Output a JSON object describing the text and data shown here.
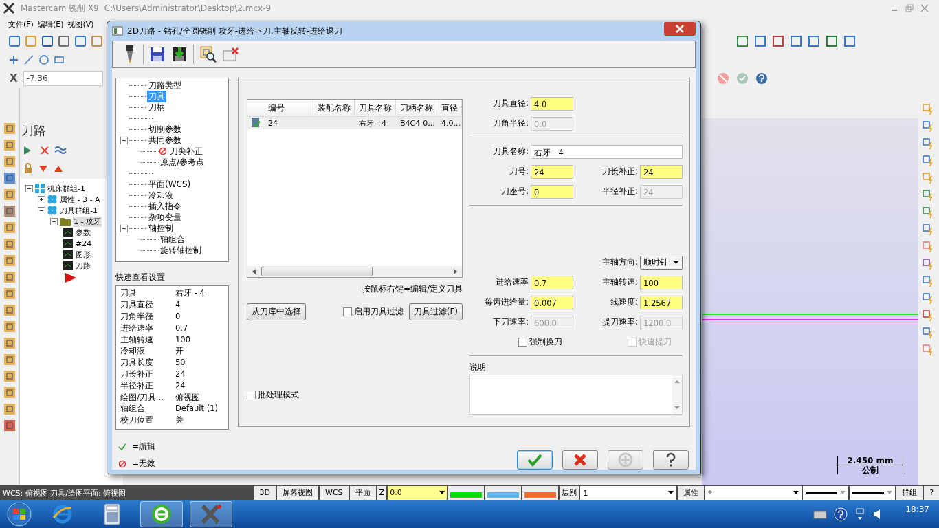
{
  "app": {
    "title": "Mastercam 铣削 X9",
    "path": "C:\\Users\\Administrator\\Desktop\\2.mcx-9",
    "menus": [
      "文件(F)",
      "编辑(E)",
      "视图(V)"
    ],
    "coordinate": {
      "label": "X",
      "value": "-7.36"
    },
    "manager": {
      "title": "刀路",
      "tree": [
        {
          "label": "机床群组-1",
          "expanded": true,
          "selected": false,
          "children": [
            {
              "label": "属性 - 3 - A",
              "expanded": false,
              "selected": false
            },
            {
              "label": "刀具群组-1",
              "expanded": true,
              "selected": false,
              "children": [
                {
                  "label": "1 - 攻牙",
                  "expanded": true,
                  "selected": true,
                  "children": [
                    {
                      "label": "参数",
                      "selected": false
                    },
                    {
                      "label": "#24",
                      "selected": false
                    },
                    {
                      "label": "图形",
                      "selected": false
                    },
                    {
                      "label": "刀路",
                      "selected": false
                    }
                  ]
                }
              ]
            }
          ]
        }
      ]
    },
    "scale": {
      "value": "2.450 mm",
      "unit": "公制"
    },
    "status_text": "WCS: 俯视图  刀具/绘图平面: 俯视图",
    "bottom_bar": [
      {
        "kind": "button",
        "text": "3D"
      },
      {
        "kind": "button",
        "text": "屏幕视图"
      },
      {
        "kind": "button",
        "text": "WCS"
      },
      {
        "kind": "button",
        "text": "平面"
      },
      {
        "kind": "label",
        "text": "Z"
      },
      {
        "kind": "field",
        "text": "0.0"
      },
      {
        "kind": "swatch",
        "color": "#00e000"
      },
      {
        "kind": "swatch",
        "color": "#60b8f0"
      },
      {
        "kind": "swatch",
        "color": "#f07030"
      },
      {
        "kind": "label",
        "text": "层别"
      },
      {
        "kind": "select",
        "text": "1"
      },
      {
        "kind": "button",
        "text": "属性"
      },
      {
        "kind": "select",
        "text": "*"
      },
      {
        "kind": "line"
      },
      {
        "kind": "line"
      },
      {
        "kind": "button",
        "text": "群组"
      },
      {
        "kind": "button",
        "text": "?"
      }
    ]
  },
  "dialog": {
    "title": "2D刀路 - 钻孔/全圆铣削 攻牙-进给下刀.主轴反转-进给退刀",
    "tree": [
      {
        "label": "刀路类型",
        "selected": false
      },
      {
        "label": "刀具",
        "selected": true
      },
      {
        "label": "刀柄",
        "selected": false
      },
      {
        "kind": "blank"
      },
      {
        "label": "切削参数",
        "selected": false
      },
      {
        "label": "共同参数",
        "selected": false,
        "expanded": true,
        "children": [
          {
            "label": "刀尖补正",
            "selected": false,
            "invalid": true
          },
          {
            "label": "原点/参考点",
            "selected": false
          }
        ]
      },
      {
        "kind": "blank"
      },
      {
        "label": "平面(WCS)",
        "selected": false
      },
      {
        "label": "冷却液",
        "selected": false
      },
      {
        "label": "插入指令",
        "selected": false
      },
      {
        "label": "杂项变量",
        "selected": false
      },
      {
        "label": "轴控制",
        "selected": false,
        "expanded": true,
        "children": [
          {
            "label": "轴组合",
            "selected": false
          },
          {
            "label": "旋转轴控制",
            "selected": false
          }
        ]
      }
    ],
    "quick_view": {
      "title": "快速查看设置",
      "rows": [
        {
          "label": "刀具",
          "value": "右牙 - 4"
        },
        {
          "label": "刀具直径",
          "value": "4"
        },
        {
          "label": "刀角半径",
          "value": "0"
        },
        {
          "label": "进给速率",
          "value": "0.7"
        },
        {
          "label": "主轴转速",
          "value": "100"
        },
        {
          "label": "冷却液",
          "value": "开"
        },
        {
          "label": "刀具长度",
          "value": "50"
        },
        {
          "label": "刀长补正",
          "value": "24"
        },
        {
          "label": "半径补正",
          "value": "24"
        },
        {
          "label": "绘图/刀具...",
          "value": "俯视图"
        },
        {
          "label": "轴组合",
          "value": "Default (1)"
        },
        {
          "label": "校刀位置",
          "value": "关"
        }
      ]
    },
    "legend": [
      {
        "kind": "edit",
        "text": "=编辑"
      },
      {
        "kind": "invalid",
        "text": "=无效"
      }
    ],
    "tool_table": {
      "columns": [
        "编号",
        "装配名称",
        "刀具名称",
        "刀柄名称",
        "直径"
      ],
      "rows": [
        {
          "cells": [
            "24",
            "",
            "右牙 - 4",
            "B4C4-0...",
            "4.0..."
          ],
          "selected": true
        }
      ]
    },
    "hint": "按鼠标右键=编辑/定义刀具",
    "library_button": "从刀库中选择",
    "filter_check": {
      "label": "启用刀具过滤",
      "checked": false
    },
    "filter_button": "刀具过滤(F)",
    "batch_check": {
      "label": "批处理模式",
      "checked": false
    },
    "sections": [
      {
        "rows": [
          [
            {
              "label": "刀具直径:",
              "value": "4.0",
              "highlighted": true,
              "disabled": false
            }
          ],
          [
            {
              "label": "刀角半径:",
              "value": "0.0",
              "highlighted": false,
              "disabled": true
            }
          ]
        ]
      },
      {
        "rows": [
          [
            {
              "kind": "wide",
              "label": "刀具名称:",
              "value": "右牙 - 4",
              "highlighted": false,
              "disabled": false
            }
          ],
          [
            {
              "label": "刀号:",
              "value": "24",
              "highlighted": true,
              "disabled": false
            },
            {
              "label": "刀长补正:",
              "value": "24",
              "highlighted": true,
              "disabled": false
            }
          ],
          [
            {
              "label": "刀座号:",
              "value": "0",
              "highlighted": true,
              "disabled": false
            },
            {
              "label": "半径补正:",
              "value": "24",
              "highlighted": false,
              "disabled": true
            }
          ]
        ]
      },
      {
        "rows": [
          [
            {
              "kind": "empty"
            },
            {
              "label": "主轴方向:",
              "value": "顺时针",
              "kind": "select"
            }
          ],
          [
            {
              "label": "进给速率",
              "value": "0.7",
              "highlighted": true,
              "disabled": false
            },
            {
              "label": "主轴转速:",
              "value": "100",
              "highlighted": true,
              "disabled": false
            }
          ],
          [
            {
              "label": "每齿进给量:",
              "value": "0.007",
              "highlighted": true,
              "disabled": false
            },
            {
              "label": "线速度:",
              "value": "1.2567",
              "highlighted": true,
              "disabled": false
            }
          ],
          [
            {
              "label": "下刀速率:",
              "value": "600.0",
              "highlighted": false,
              "disabled": true
            },
            {
              "label": "提刀速率:",
              "value": "1200.0",
              "highlighted": false,
              "disabled": true
            }
          ],
          [
            {
              "kind": "check",
              "label": "强制换刀",
              "checked": false,
              "disabled": false
            },
            {
              "kind": "check",
              "label": "快速提刀",
              "checked": false,
              "disabled": true
            }
          ]
        ]
      }
    ],
    "notes_label": "说明"
  },
  "taskbar": {
    "apps": [
      {
        "kind": "ie",
        "running": false
      },
      {
        "kind": "calculator",
        "running": false
      },
      {
        "kind": "browser",
        "running": true
      },
      {
        "kind": "mastercam",
        "running": true
      }
    ],
    "clock": "18:37"
  }
}
